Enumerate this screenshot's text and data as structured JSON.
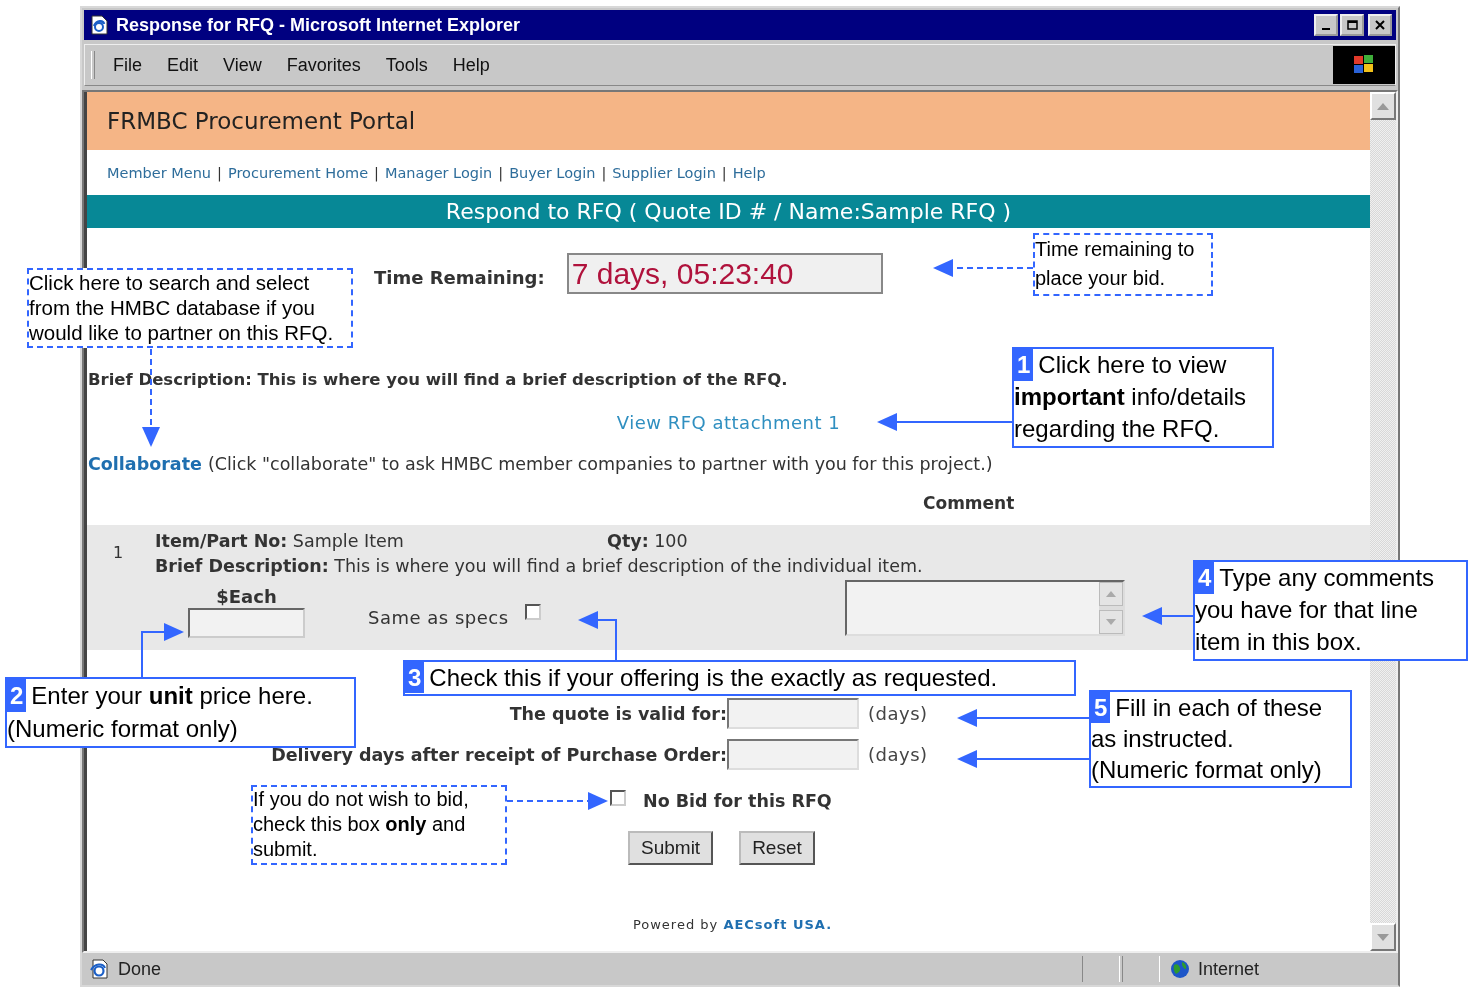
{
  "window": {
    "title": "Response for RFQ - Microsoft Internet Explorer"
  },
  "menu": [
    "File",
    "Edit",
    "View",
    "Favorites",
    "Tools",
    "Help"
  ],
  "portal": {
    "title": "FRMBC Procurement Portal",
    "nav_links": [
      "Member Menu",
      "Procurement Home",
      "Manager Login",
      "Buyer Login",
      "Supplier Login",
      "Help"
    ],
    "nav_separator": "|",
    "banner": "Respond to RFQ ( Quote ID # / Name:Sample RFQ )"
  },
  "time_remaining": {
    "label": "Time Remaining:",
    "value": "7 days, 05:23:40"
  },
  "brief_description": "Brief Description: This is where you will find a brief description of the RFQ.",
  "attachment_link": "View RFQ attachment 1",
  "collaborate": {
    "link": "Collaborate",
    "note": "(Click \"collaborate\" to ask HMBC member companies to partner with you for this project.)"
  },
  "comment_header": "Comment",
  "line_items": [
    {
      "number": "1",
      "part": "**Item/Part No:** Sample Item",
      "qty": "**Qty:** 100",
      "description": "**Brief Description:** This is where you will find a brief description of the individual item.",
      "price_label": "$Each",
      "same_as_specs_label": "Same as specs",
      "same_as_specs_checked": false
    }
  ],
  "quote_fields": [
    {
      "label": "The quote is valid for:",
      "unit": "(days)"
    },
    {
      "label": "Delivery days after receipt of Purchase Order:",
      "unit": "(days)"
    }
  ],
  "no_bid": {
    "label": "No Bid for this RFQ",
    "checked": false
  },
  "buttons": [
    "Submit",
    "Reset"
  ],
  "footer": "Powered by **AECsoft USA.**",
  "status_bar": {
    "text": "Done",
    "zone": "Internet"
  },
  "annotations": [
    {
      "kind": "note",
      "lines": [
        "Time remaining to",
        "place your bid."
      ]
    },
    {
      "kind": "note",
      "lines": [
        "Click here to search and select",
        "from the HMBC database if you",
        "would like to partner on this RFQ."
      ]
    },
    {
      "kind": "step",
      "number": "1",
      "lines": [
        "Click here to view",
        "**important** info/details",
        "regarding the RFQ."
      ]
    },
    {
      "kind": "step",
      "number": "4",
      "lines": [
        "Type any comments",
        "you have for that line",
        "item in this box."
      ]
    },
    {
      "kind": "step",
      "number": "3",
      "lines": [
        "Check this if your offering is the exactly as requested."
      ]
    },
    {
      "kind": "step",
      "number": "2",
      "lines": [
        "Enter your **unit** price here.",
        "(Numeric format only)"
      ]
    },
    {
      "kind": "step",
      "number": "5",
      "lines": [
        "Fill in each of these",
        "as instructed.",
        "(Numeric format only)"
      ]
    },
    {
      "kind": "note",
      "lines": [
        "If you do not wish to bid,",
        "check this box **only** and",
        "submit."
      ]
    }
  ]
}
